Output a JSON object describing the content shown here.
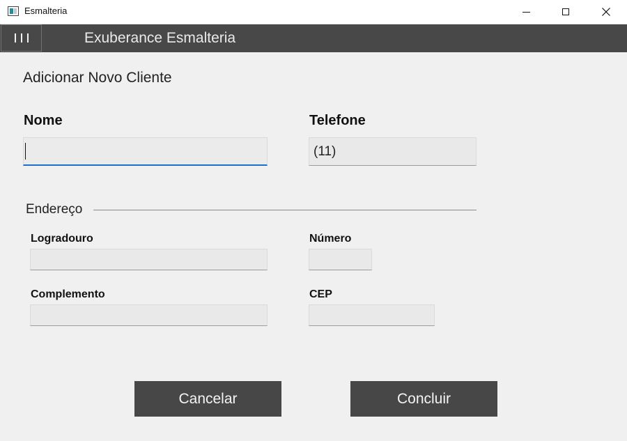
{
  "window": {
    "title": "Esmalteria"
  },
  "header": {
    "app_name": "Exuberance Esmalteria"
  },
  "form": {
    "title": "Adicionar Novo Cliente",
    "nome": {
      "label": "Nome",
      "value": ""
    },
    "telefone": {
      "label": "Telefone",
      "value": "(11)"
    },
    "endereco": {
      "legend": "Endereço",
      "logradouro": {
        "label": "Logradouro",
        "value": ""
      },
      "numero": {
        "label": "Número",
        "value": ""
      },
      "complemento": {
        "label": "Complemento",
        "value": ""
      },
      "cep": {
        "label": "CEP",
        "value": ""
      }
    }
  },
  "actions": {
    "cancel_label": "Cancelar",
    "confirm_label": "Concluir"
  },
  "colors": {
    "header_bg": "#484848",
    "button_bg": "#474747",
    "focus_accent": "#1a6fc9"
  }
}
